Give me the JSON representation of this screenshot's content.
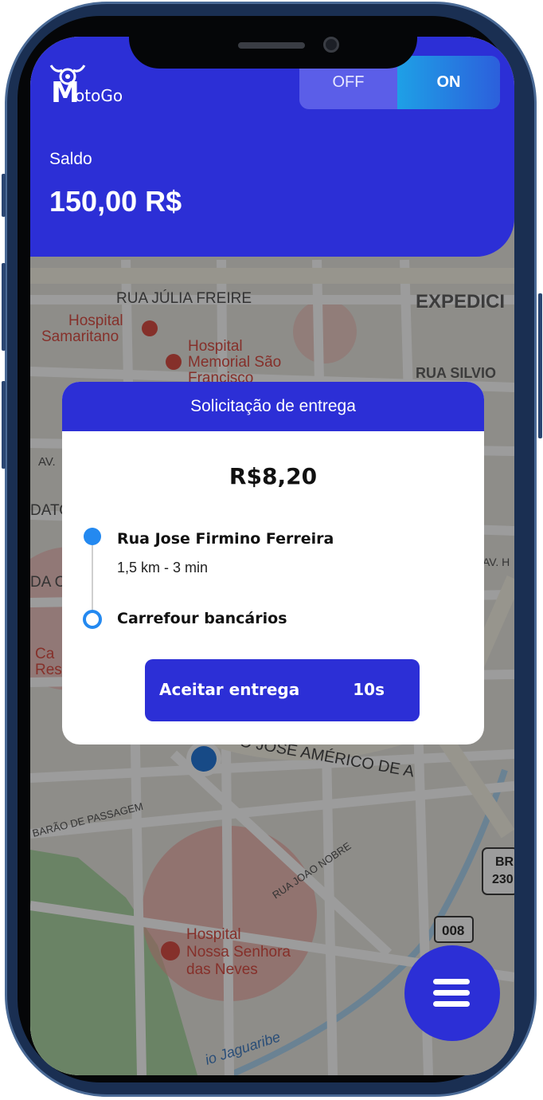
{
  "app": {
    "logo_initial": "M",
    "logo_rest": "otoGo"
  },
  "status_toggle": {
    "off_label": "OFF",
    "on_label": "ON",
    "selected": "ON"
  },
  "balance": {
    "label": "Saldo",
    "value": "150,00 R$"
  },
  "delivery_request": {
    "title": "Solicitação de entrega",
    "price": "R$8,20",
    "pickup": "Rua Jose Firmino Ferreira",
    "distance_time": "1,5 km - 3 min",
    "dropoff": "Carrefour bancários",
    "accept_label": "Aceitar entrega",
    "countdown": "10s"
  },
  "map": {
    "labels": [
      "RUA JÚLIA FREIRE",
      "EXPEDICI",
      "Hospital",
      "Samaritano",
      "Hospital",
      "Memorial São",
      "Francisco",
      "RUA SILVIO",
      "AV.",
      "DATO",
      "DA C",
      "AV. H",
      "Ca",
      "Res",
      "O JOSÉ AMÉRICO DE A",
      "BARÃO DE PASSAGEM",
      "RUA JOAO NOBRE",
      "BR",
      "230",
      "008",
      "Hospital",
      "Nossa Senhora",
      "das Neves",
      "io Jaguaribe"
    ]
  },
  "colors": {
    "primary": "#2c2fd6",
    "accent_blue": "#2489f0",
    "toggle_on_start": "#1ea0e6",
    "phone_frame": "#1a2f52"
  },
  "icons": {
    "menu": "hamburger-menu-icon",
    "logo": "helmet-logo-icon",
    "location": "current-location-icon",
    "hospital": "hospital-icon"
  }
}
